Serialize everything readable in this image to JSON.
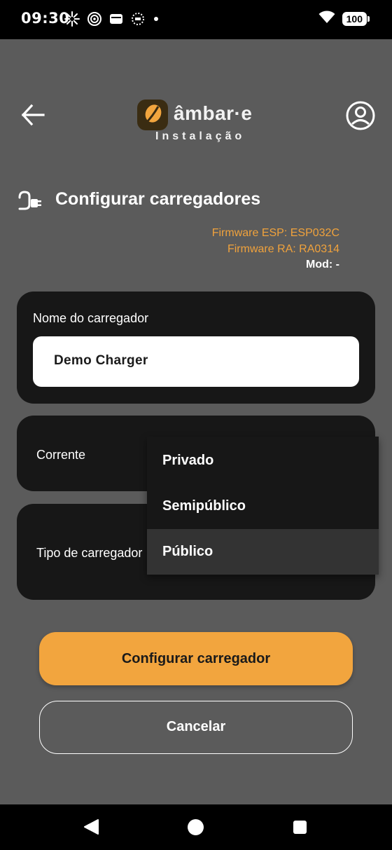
{
  "status_bar": {
    "time": "09:30",
    "battery": "100",
    "icons": [
      "sparkle-icon",
      "target-icon",
      "wallet-icon",
      "dotted-circle-icon",
      "dot-icon",
      "wifi-icon",
      "battery-icon"
    ]
  },
  "header": {
    "brand": "âmbar·e",
    "subtitle": "Instalação",
    "back_icon": "arrow-left-icon",
    "profile_icon": "account-circle-icon"
  },
  "section": {
    "title": "Configurar carregadores",
    "icon": "ev-plug-icon"
  },
  "firmware": {
    "esp": "Firmware ESP: ESP032C",
    "ra": "Firmware RA: RA0314",
    "mod": "Mod: -"
  },
  "form": {
    "name_label": "Nome do carregador",
    "name_value": "Demo Charger",
    "current_label": "Corrente",
    "type_label": "Tipo de carregador"
  },
  "dropdown": {
    "options": [
      "Privado",
      "Semipúblico",
      "Público"
    ],
    "selected": "Público"
  },
  "buttons": {
    "configure": "Configurar carregador",
    "cancel": "Cancelar"
  },
  "colors": {
    "accent": "#f2a53e",
    "firmware_text": "#f0a23c",
    "card_bg": "#171717",
    "page_bg": "#5b5b5b"
  }
}
